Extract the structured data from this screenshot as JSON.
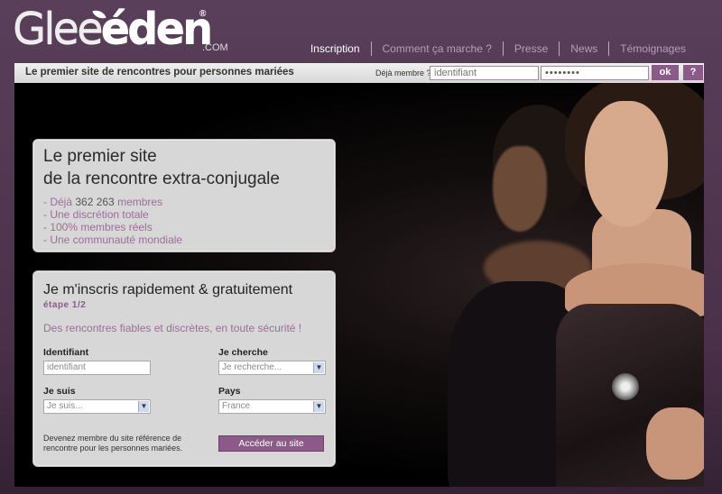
{
  "logo": {
    "brand_light": "Glee",
    "brand_bold": "den",
    "reg": "®",
    "suffix": ".COM"
  },
  "nav": {
    "items": [
      "Inscription",
      "Comment ça marche ?",
      "Presse",
      "News",
      "Témoignages"
    ]
  },
  "bar": {
    "tagline": "Le premier site de rencontres pour personnes mariées",
    "member_label": "Déjà membre ?",
    "login_placeholder": "identifiant",
    "password_value": "••••••••",
    "ok_label": "ok",
    "help_label": "?"
  },
  "promo": {
    "headline_1": "Le premier site",
    "headline_2": "de la rencontre extra-conjugale",
    "bullet_1_pre": "- Déjà ",
    "member_count": "362 263",
    "bullet_1_post": " membres",
    "bullet_2": "- Une discrétion totale",
    "bullet_3": "- 100% membres réels",
    "bullet_4": "- Une communauté mondiale"
  },
  "signup": {
    "title": "Je m'inscris rapidement & gratuitement",
    "step": "étape 1/2",
    "subtitle": "Des rencontres fiables et discrètes, en toute sécurité !",
    "username_label": "Identifiant",
    "username_placeholder": "identifiant",
    "seeking_label": "Je cherche",
    "seeking_value": "Je recherche...",
    "iam_label": "Je suis",
    "iam_value": "Je suis...",
    "country_label": "Pays",
    "country_value": "France",
    "footer_text": "Devenez membre du site référence de rencontre pour les personnes mariées.",
    "submit_label": "Accéder au site"
  },
  "colors": {
    "accent": "#8c5a88",
    "background": "#4a3049",
    "panel": "#d7d7d7"
  }
}
